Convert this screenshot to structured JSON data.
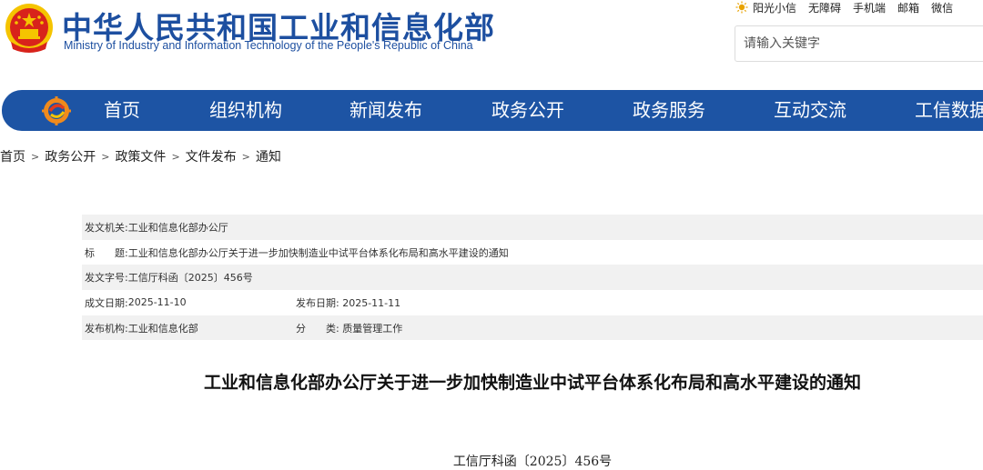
{
  "header": {
    "title": "中华人民共和国工业和信息化部",
    "subtitle": "Ministry of Industry and Information Technology of the People's Republic of China",
    "top_links": [
      "阳光小信",
      "无障碍",
      "手机端",
      "邮箱",
      "微信"
    ],
    "search_placeholder": "请输入关键字"
  },
  "nav": {
    "items": [
      "首页",
      "组织机构",
      "新闻发布",
      "政务公开",
      "政务服务",
      "互动交流",
      "工信数据"
    ]
  },
  "breadcrumb": [
    "首页",
    "政务公开",
    "政策文件",
    "文件发布",
    "通知"
  ],
  "info": {
    "issuer_label": "发文机关:",
    "issuer": "工业和信息化部办公厅",
    "title_label": "标　　题:",
    "title": "工业和信息化部办公厅关于进一步加快制造业中试平台体系化布局和高水平建设的通知",
    "doc_no_label": "发文字号:",
    "doc_no": "工信厅科函〔2025〕456号",
    "created_label": "成文日期:",
    "created": "2025-11-10",
    "published_label": "发布日期:",
    "published": "2025-11-11",
    "org_label": "发布机构:",
    "org": "工业和信息化部",
    "category_label": "分　　类:",
    "category": "质量管理工作"
  },
  "document": {
    "title": "工业和信息化部办公厅关于进一步加快制造业中试平台体系化布局和高水平建设的通知",
    "number": "工信厅科函〔2025〕456号"
  },
  "colors": {
    "brand_blue": "#1d54a4",
    "title_blue": "#1d4fa0",
    "emblem_red": "#d8231b",
    "emblem_gold": "#f5c400"
  }
}
